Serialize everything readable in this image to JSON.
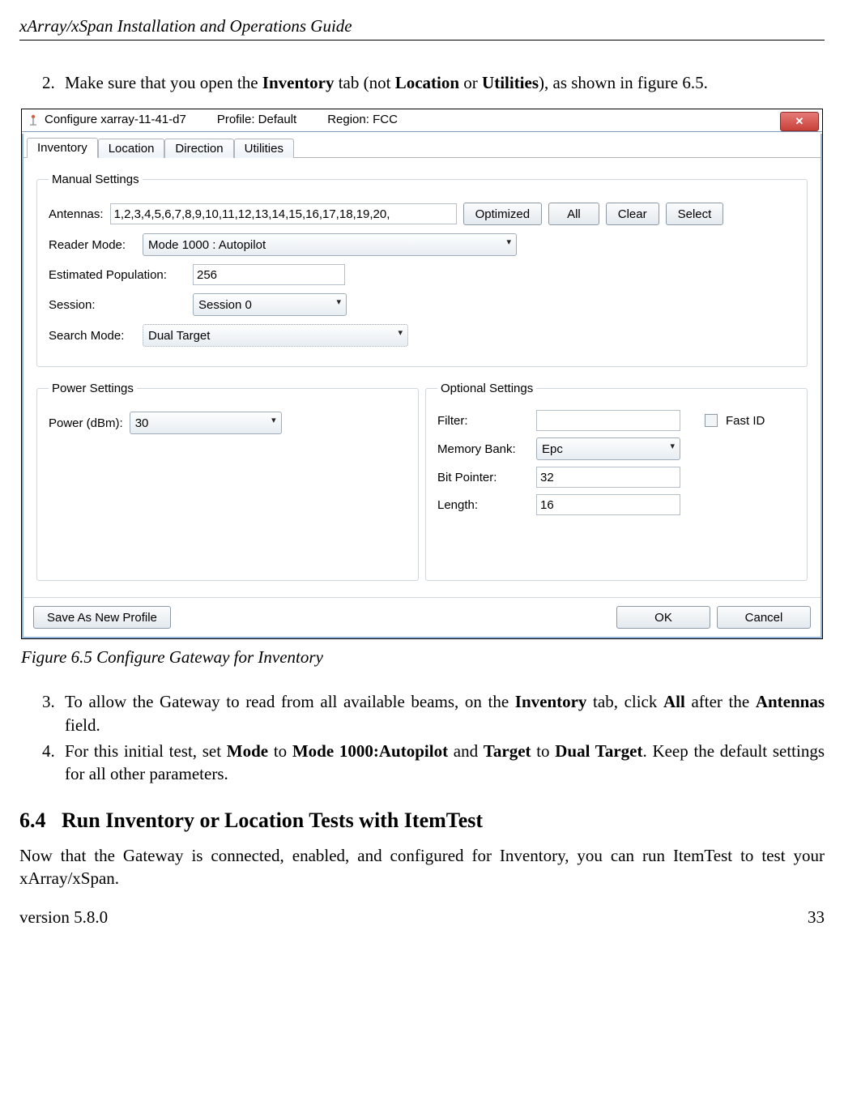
{
  "header": {
    "running_title": "xArray/xSpan Installation and Operations Guide"
  },
  "steps": {
    "s2_num": "2.",
    "s2_a": "Make sure that you open the ",
    "s2_b": "Inventory",
    "s2_c": " tab (not ",
    "s2_d": "Location",
    "s2_e": " or ",
    "s2_f": "Utilities",
    "s2_g": "), as shown in figure 6.5.",
    "s3_num": "3.",
    "s3_a": "To allow the Gateway to read from all available beams, on the ",
    "s3_b": "Inventory",
    "s3_c": " tab, click ",
    "s3_d": "All",
    "s3_e": " after the ",
    "s3_f": "Antennas",
    "s3_g": " field.",
    "s4_num": "4.",
    "s4_a": "For this initial test, set ",
    "s4_b": "Mode",
    "s4_c": " to ",
    "s4_d": "Mode 1000:Autopilot",
    "s4_e": " and ",
    "s4_f": "Target",
    "s4_g": " to ",
    "s4_h": "Dual Target",
    "s4_i": ". Keep the default settings for all other parameters."
  },
  "window": {
    "title_a": "Configure xarray-11-41-d7",
    "title_b": "Profile: Default",
    "title_c": "Region: FCC",
    "tabs": {
      "inventory": "Inventory",
      "location": "Location",
      "direction": "Direction",
      "utilities": "Utilities"
    },
    "manual": {
      "legend": "Manual Settings",
      "antennas_label": "Antennas:",
      "antennas_value": "1,2,3,4,5,6,7,8,9,10,11,12,13,14,15,16,17,18,19,20,",
      "btn_optimized": "Optimized",
      "btn_all": "All",
      "btn_clear": "Clear",
      "btn_select": "Select",
      "reader_mode_label": "Reader Mode:",
      "reader_mode_value": "Mode 1000 : Autopilot",
      "est_pop_label": "Estimated Population:",
      "est_pop_value": "256",
      "session_label": "Session:",
      "session_value": "Session 0",
      "search_mode_label": "Search Mode:",
      "search_mode_value": "Dual Target"
    },
    "power": {
      "legend": "Power Settings",
      "power_label": "Power (dBm):",
      "power_value": "30"
    },
    "optional": {
      "legend": "Optional Settings",
      "filter_label": "Filter:",
      "filter_value": "",
      "fastid_label": "Fast ID",
      "membank_label": "Memory Bank:",
      "membank_value": "Epc",
      "bitptr_label": "Bit Pointer:",
      "bitptr_value": "32",
      "length_label": "Length:",
      "length_value": "16"
    },
    "bottom": {
      "save_profile": "Save As New Profile",
      "ok": "OK",
      "cancel": "Cancel"
    }
  },
  "figure_caption": "Figure 6.5 Configure Gateway for Inventory",
  "section": {
    "num": "6.4",
    "title": "Run Inventory or Location Tests with ItemTest",
    "para": "Now that the Gateway is connected, enabled, and configured for Inventory, you can run ItemTest to test your xArray/xSpan."
  },
  "footer": {
    "version": "version 5.8.0",
    "page": "33"
  }
}
